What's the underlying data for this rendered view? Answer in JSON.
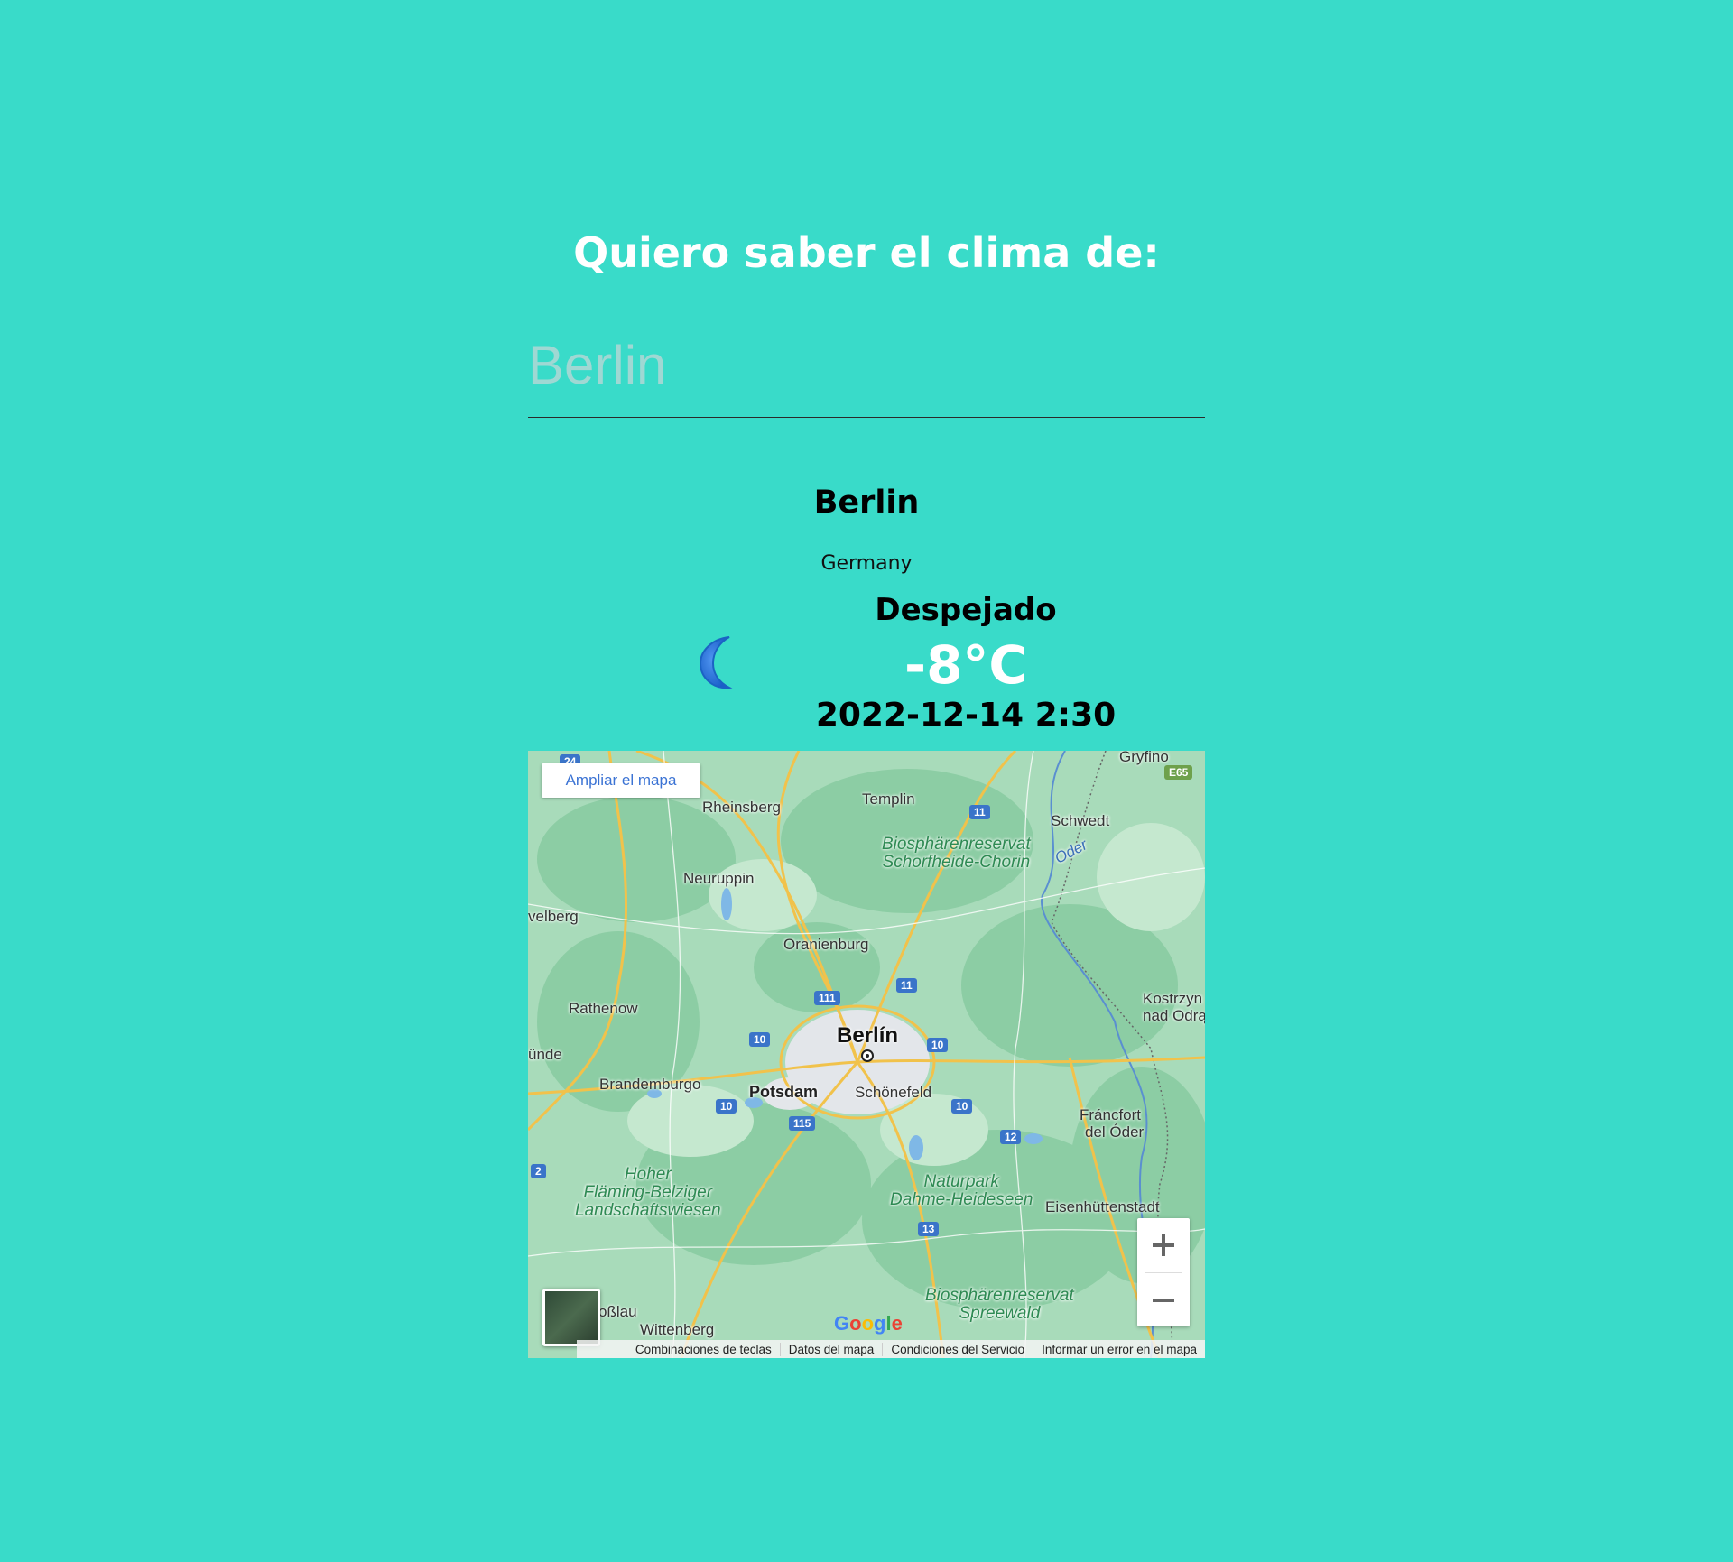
{
  "header": {
    "title": "Quiero saber el clima de:"
  },
  "search": {
    "value": "",
    "placeholder": "Berlin"
  },
  "weather": {
    "city": "Berlin",
    "country": "Germany",
    "description": "Despejado",
    "temperature": "-8°C",
    "datetime": "2022-12-14 2:30",
    "icon": "crescent-moon-icon"
  },
  "map": {
    "enlarge_label": "Ampliar el mapa",
    "zoom_in_icon": "plus-icon",
    "zoom_out_icon": "minus-icon",
    "logo": "Google",
    "footer_links": [
      "Combinaciones de teclas",
      "Datos del mapa",
      "Condiciones del Servicio",
      "Informar un error en el mapa"
    ],
    "places": [
      {
        "id": "gryfino",
        "label": "Gryfino"
      },
      {
        "id": "templin",
        "label": "Templin"
      },
      {
        "id": "rheinsberg",
        "label": "Rheinsberg"
      },
      {
        "id": "schwedt",
        "label": "Schwedt"
      },
      {
        "id": "neuruppin",
        "label": "Neuruppin"
      },
      {
        "id": "oranienburg",
        "label": "Oranienburg"
      },
      {
        "id": "havelberg",
        "label": "velberg"
      },
      {
        "id": "rathenow",
        "label": "Rathenow"
      },
      {
        "id": "berlin",
        "label": "Berlín"
      },
      {
        "id": "kostrzyn1",
        "label": "Kostrzyn"
      },
      {
        "id": "kostrzyn2",
        "label": "nad Odrą"
      },
      {
        "id": "brandenburg",
        "label": "Brandemburgo"
      },
      {
        "id": "potsdam",
        "label": "Potsdam"
      },
      {
        "id": "schoenefeld",
        "label": "Schönefeld"
      },
      {
        "id": "frankfurt1",
        "label": "Fráncfort"
      },
      {
        "id": "frankfurt2",
        "label": "del Óder"
      },
      {
        "id": "eisenhuettenstadt",
        "label": "Eisenhüttenstadt"
      },
      {
        "id": "wittenberg",
        "label": "Wittenberg"
      },
      {
        "id": "rosslau",
        "label": "oßlau"
      },
      {
        "id": "unde",
        "label": "ünde"
      },
      {
        "id": "oder",
        "label": "Oder"
      }
    ],
    "parks": [
      {
        "id": "schorfheide",
        "line1": "Biosphärenreservat",
        "line2": "Schorfheide-Chorin"
      },
      {
        "id": "flaeming",
        "line1": "Hoher",
        "line2": "Fläming-Belziger",
        "line3": "Landschaftswiesen"
      },
      {
        "id": "dahme",
        "line1": "Naturpark",
        "line2": "Dahme-Heideseen"
      },
      {
        "id": "spreewald",
        "line1": "Biosphärenreservat",
        "line2": "Spreewald"
      }
    ],
    "shields": [
      "24",
      "11",
      "E65",
      "111",
      "11",
      "10",
      "10",
      "10",
      "115",
      "10",
      "12",
      "2",
      "13"
    ]
  }
}
